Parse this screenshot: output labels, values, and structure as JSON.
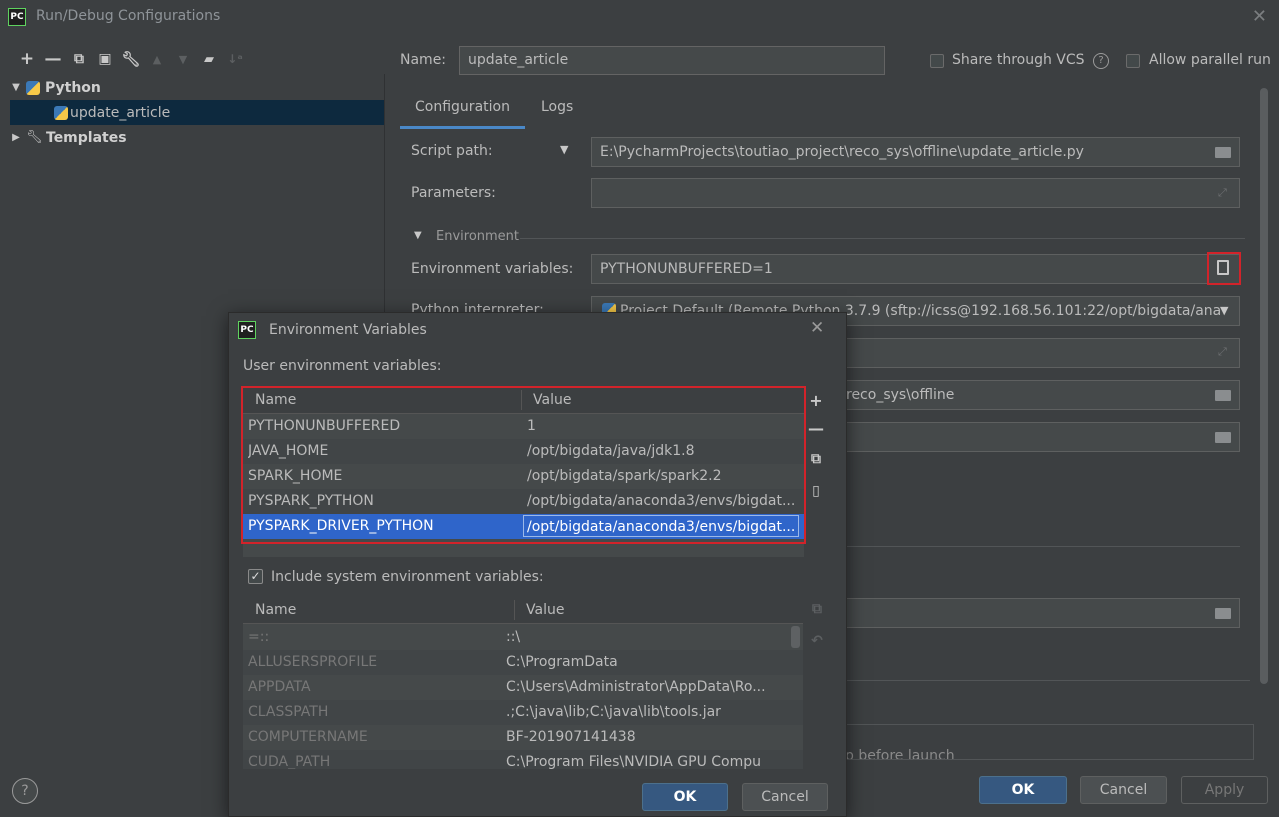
{
  "window": {
    "title": "Run/Debug Configurations",
    "logo_text": "PC"
  },
  "toolbar": {
    "icons": [
      "add-icon",
      "remove-icon",
      "copy-icon",
      "save-icon",
      "wrench-icon",
      "move-up-icon",
      "move-down-icon",
      "folder-add-icon",
      "sort-icon"
    ]
  },
  "tree": {
    "python": "Python",
    "config": "update_article",
    "templates": "Templates"
  },
  "header": {
    "name_label": "Name:",
    "name_value": "update_article",
    "share_vcs": "Share through VCS",
    "allow_parallel": "Allow parallel run"
  },
  "tabs": [
    "Configuration",
    "Logs"
  ],
  "form": {
    "script_path_label": "Script path:",
    "script_path_value": "E:\\PycharmProjects\\toutiao_project\\reco_sys\\offline\\update_article.py",
    "parameters_label": "Parameters:",
    "parameters_value": "",
    "environment_section": "Environment",
    "env_vars_label": "Environment variables:",
    "env_vars_value": "PYTHONUNBUFFERED=1",
    "interpreter_label": "Python interpreter:",
    "interpreter_value": "Project Default (Remote Python 3.7.9 (sftp://icss@192.168.56.101:22/opt/bigdata/ana",
    "working_dir_partial": "reco_sys\\offline",
    "before_launch_partial": "p before launch"
  },
  "footer": {
    "ok": "OK",
    "cancel": "Cancel",
    "apply": "Apply",
    "help": "?"
  },
  "dialog": {
    "title": "Environment Variables",
    "user_section": "User environment variables:",
    "col_name": "Name",
    "col_value": "Value",
    "user_vars": [
      {
        "name": "PYTHONUNBUFFERED",
        "value": "1"
      },
      {
        "name": "JAVA_HOME",
        "value": "/opt/bigdata/java/jdk1.8"
      },
      {
        "name": "SPARK_HOME",
        "value": "/opt/bigdata/spark/spark2.2"
      },
      {
        "name": "PYSPARK_PYTHON",
        "value": "/opt/bigdata/anaconda3/envs/bigdat..."
      },
      {
        "name": "PYSPARK_DRIVER_PYTHON",
        "value": "/opt/bigdata/anaconda3/envs/bigdat..."
      }
    ],
    "include_system": "Include system environment variables:",
    "system_vars": [
      {
        "name": "=::",
        "value": "::\\"
      },
      {
        "name": "ALLUSERSPROFILE",
        "value": "C:\\ProgramData"
      },
      {
        "name": "APPDATA",
        "value": "C:\\Users\\Administrator\\AppData\\Ro..."
      },
      {
        "name": "CLASSPATH",
        "value": ".;C:\\java\\lib;C:\\java\\lib\\tools.jar"
      },
      {
        "name": "COMPUTERNAME",
        "value": "BF-201907141438"
      },
      {
        "name": "CUDA_PATH",
        "value": "C:\\Program Files\\NVIDIA GPU Compu"
      }
    ],
    "ok": "OK",
    "cancel": "Cancel"
  },
  "colors": {
    "highlight_red": "#d2232a",
    "selection_blue": "#2f65ca",
    "primary_button": "#365880"
  }
}
